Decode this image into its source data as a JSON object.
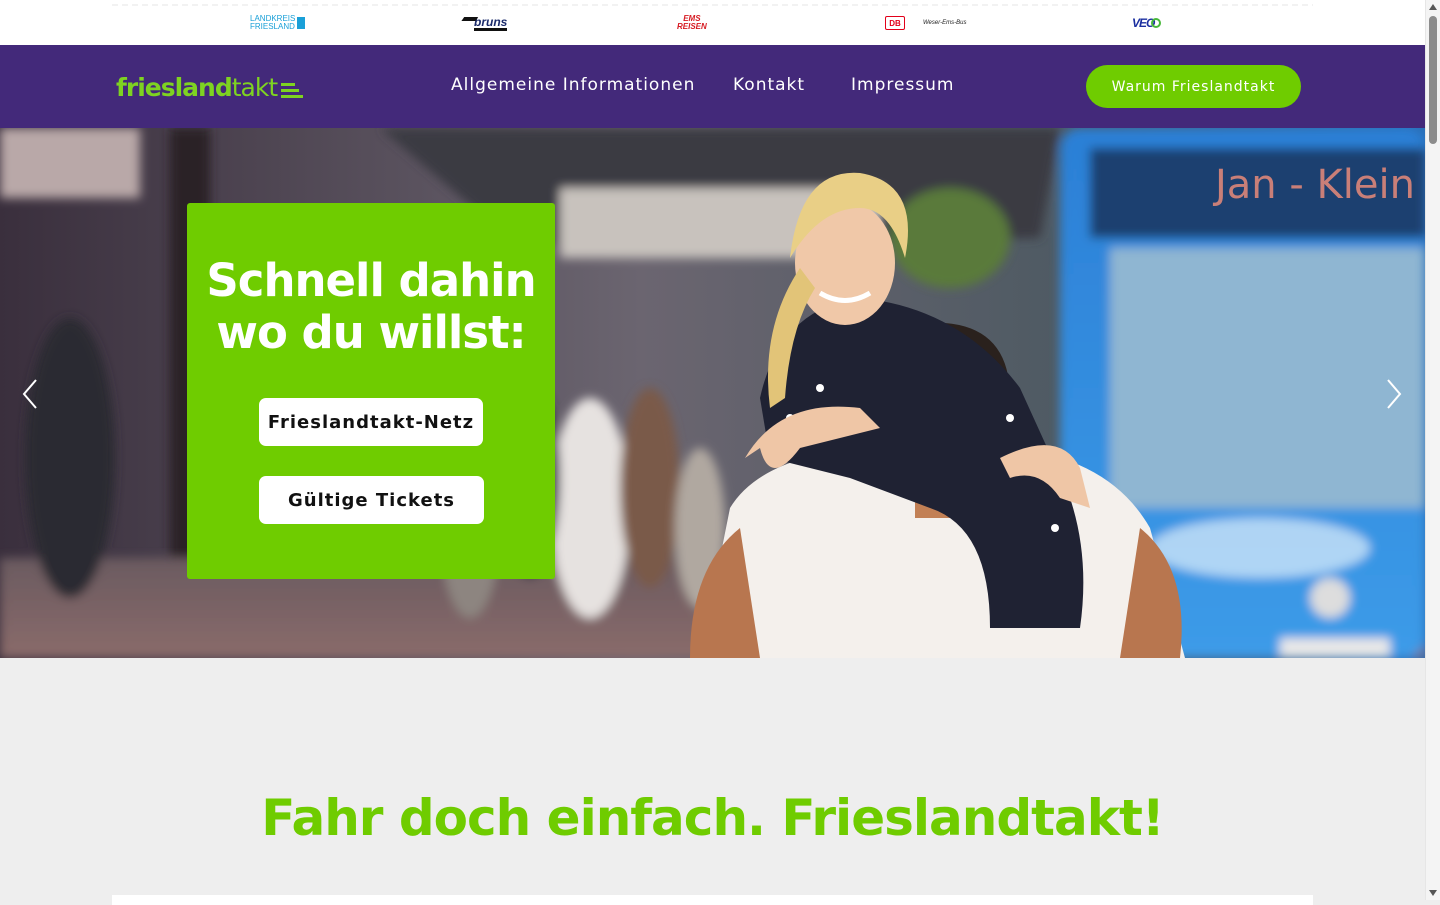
{
  "partners": {
    "landkreis_line1": "LANDKREIS",
    "landkreis_line2": "FRIESLAND",
    "bruns": "bruns",
    "ems_line1": "EMS",
    "ems_line2": "REISEN",
    "db": "DB",
    "weser_ems": "Weser-Ems-Bus",
    "veo": "VEO"
  },
  "header": {
    "brand_bold": "friesland",
    "brand_light": "takt",
    "nav": [
      "Allgemeine Informationen",
      "Kontakt",
      "Impressum"
    ],
    "cta_label": "Warum Frieslandtakt"
  },
  "hero": {
    "title_line1": "Schnell dahin",
    "title_line2": "wo du willst:",
    "btn_network": "Frieslandtakt-Netz",
    "btn_tickets": "Gültige Tickets",
    "bus_sign": "Jan - Klein"
  },
  "content": {
    "tagline": "Fahr doch einfach. Frieslandtakt!"
  },
  "colors": {
    "brand_green": "#6fcc00",
    "header_purple": "#43297a",
    "tagline_green": "#6fcc00"
  }
}
